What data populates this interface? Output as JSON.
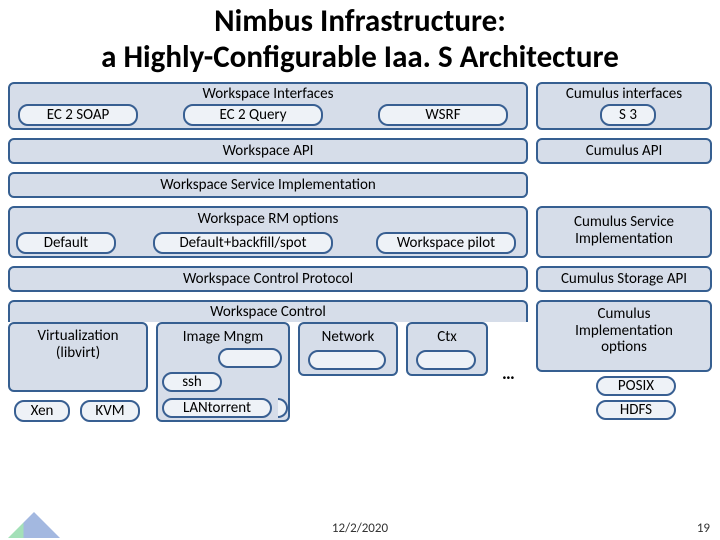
{
  "title_line1": "Nimbus Infrastructure:",
  "title_line2": "a Highly-Configurable Iaa. S Architecture",
  "workspace_interfaces": "Workspace Interfaces",
  "cumulus_interfaces": "Cumulus interfaces",
  "ec2_soap": "EC 2 SOAP",
  "ec2_query": "EC 2 Query",
  "wsrf": "WSRF",
  "s3": "S 3",
  "workspace_api": "Workspace API",
  "cumulus_api": "Cumulus API",
  "ws_service_impl": "Workspace Service Implementation",
  "ws_rm_options": "Workspace RM options",
  "cumulus_service_impl_l1": "Cumulus Service",
  "cumulus_service_impl_l2": "Implementation",
  "default": "Default",
  "default_backfill": "Default+backfill/spot",
  "ws_pilot": "Workspace pilot",
  "ws_ctrl_protocol": "Workspace Control Protocol",
  "cumulus_storage_api": "Cumulus Storage API",
  "ws_control": "Workspace Control",
  "cumulus_impl_opts_l1": "Cumulus",
  "cumulus_impl_opts_l2": "Implementation",
  "cumulus_impl_opts_l3": "options",
  "virt_l1": "Virtualization",
  "virt_l2": "(libvirt)",
  "image_mgmt": "Image Mngm",
  "network": "Network",
  "ctx": "Ctx",
  "ssh": "ssh",
  "xen": "Xen",
  "kvm": "KVM",
  "lantorrent": "LANtorrent",
  "posix": "POSIX",
  "hdfs": "HDFS",
  "dots": "…",
  "date": "12/2/2020",
  "page": "19"
}
